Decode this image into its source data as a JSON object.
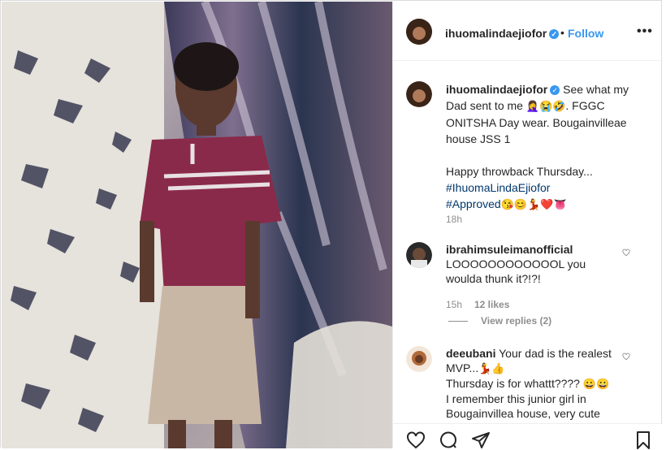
{
  "post": {
    "username": "ihuomalindaejiofor",
    "verified_icon": "✓",
    "follow_label": "Follow",
    "more_label": "•••",
    "separator": "•"
  },
  "caption": {
    "username": "ihuomalindaejiofor",
    "text_line1": "See what my Dad sent to me",
    "emojis1": "🤦‍♀️😭🤣",
    "text_line2": ". FGGC ONITSHA Day wear. Bougainvilleae house JSS 1",
    "text_line3": "Happy throwback Thursday...",
    "hashtag1": "#IhuomaLindaEjiofor",
    "hashtag2": "#Approved",
    "emojis2": "😘😊💃❤️👅",
    "time": "18h"
  },
  "comments": [
    {
      "username": "ibrahimsuleimanofficial",
      "text": "LOOOOOOOOOOOOL you woulda thunk it?!?!",
      "time": "15h",
      "likes": "12 likes",
      "view_replies": "View replies (2)"
    },
    {
      "username": "deeubani",
      "text_line1": "Your dad is the realest MVP...",
      "emojis1": "💃👍",
      "text_line2": "Thursday is for whattt????",
      "emojis2": "😀😀",
      "text_line3": "I remember this junior girl in Bougainvillea house, very cute"
    }
  ],
  "actions": {
    "like_icon": "heart-icon",
    "comment_icon": "comment-icon",
    "share_icon": "share-icon",
    "save_icon": "bookmark-icon"
  },
  "colors": {
    "accent": "#3897f0",
    "text": "#262626",
    "muted": "#8e8e8e",
    "hashtag": "#00376b"
  }
}
